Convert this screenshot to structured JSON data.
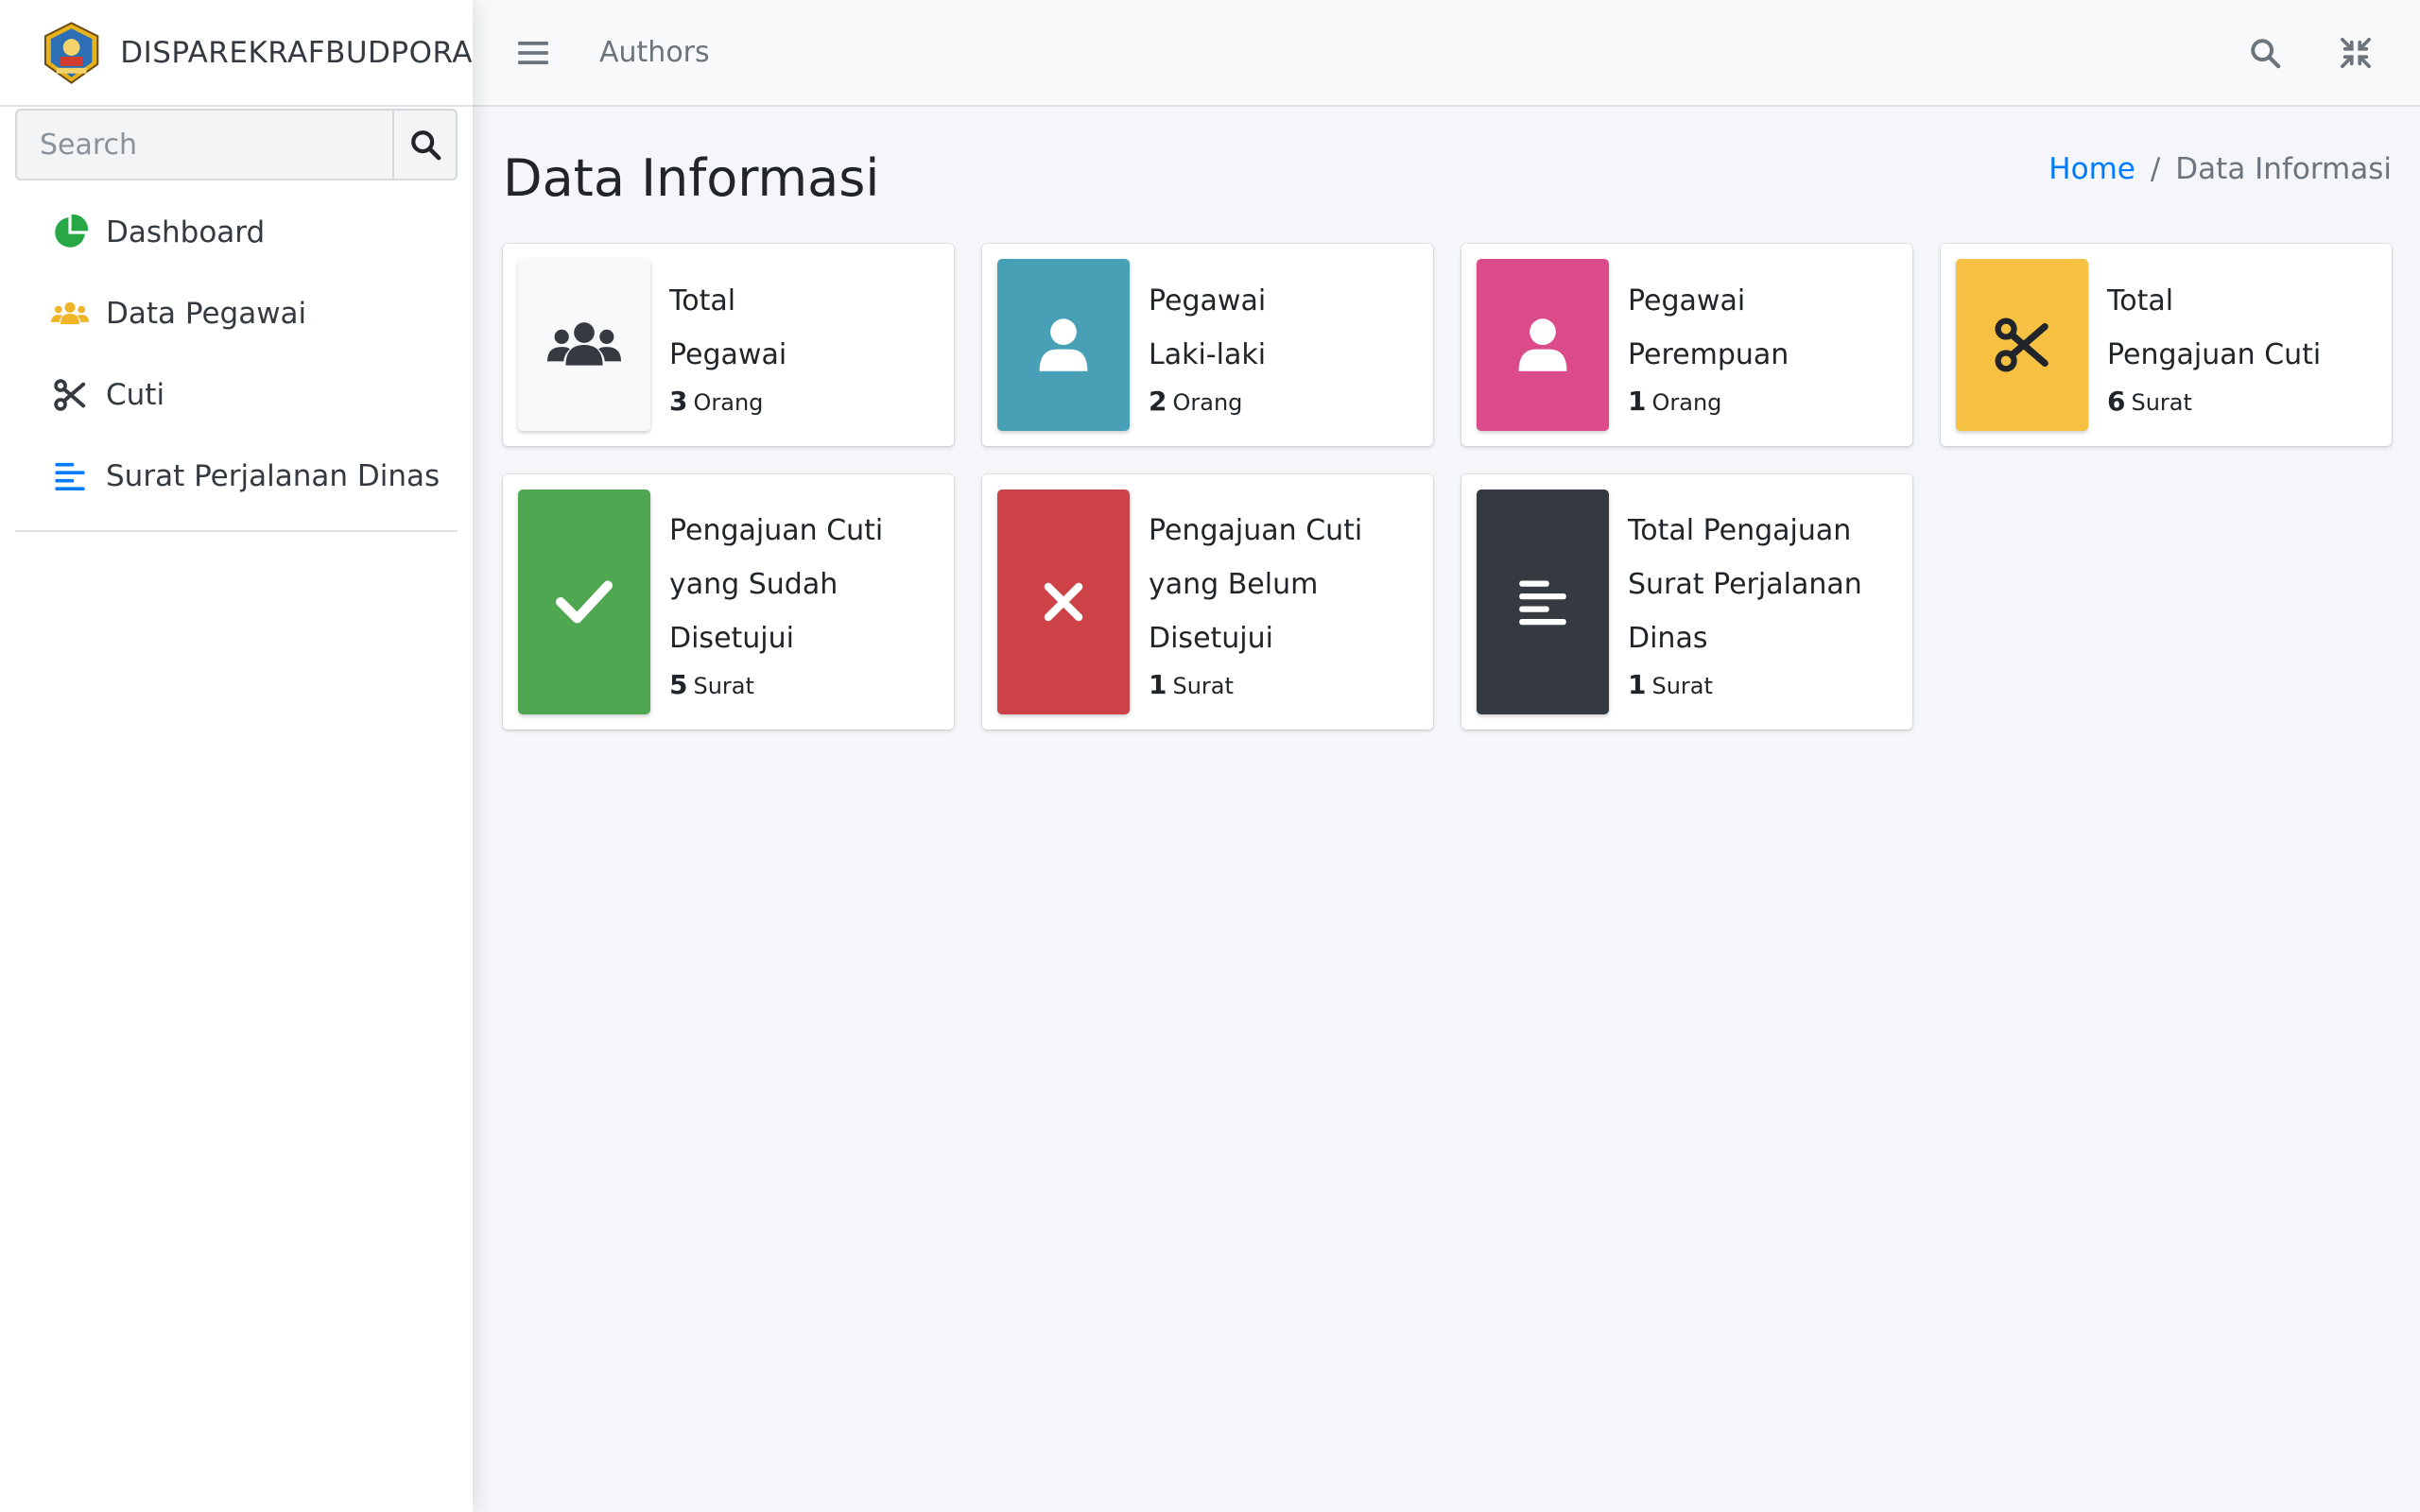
{
  "brand": {
    "name": "DISPAREKRAFBUDPORA"
  },
  "search": {
    "placeholder": "Search"
  },
  "sidebar": {
    "items": [
      {
        "label": "Dashboard",
        "icon": "chart-pie-icon",
        "color": "#28a745"
      },
      {
        "label": "Data Pegawai",
        "icon": "users-icon",
        "color": "#f0b429"
      },
      {
        "label": "Cuti",
        "icon": "scissors-icon",
        "color": "#343a40"
      },
      {
        "label": "Surat Perjalanan Dinas",
        "icon": "align-left-icon",
        "color": "#007bff"
      }
    ]
  },
  "topbar": {
    "link": "Authors"
  },
  "header": {
    "title": "Data Informasi",
    "breadcrumb": {
      "home": "Home",
      "separator": "/",
      "current": "Data Informasi"
    }
  },
  "boxes": [
    {
      "lines": [
        "Total",
        "Pegawai"
      ],
      "value": "3",
      "unit": "Orang",
      "icon": "users-icon",
      "bg": "#f8f9fa"
    },
    {
      "lines": [
        "Pegawai",
        "Laki-laki"
      ],
      "value": "2",
      "unit": "Orang",
      "icon": "user-icon",
      "bg": "#48a0b7"
    },
    {
      "lines": [
        "Pegawai",
        "Perempuan"
      ],
      "value": "1",
      "unit": "Orang",
      "icon": "user-icon",
      "bg": "#db4b8a"
    },
    {
      "lines": [
        "Total",
        "Pengajuan Cuti"
      ],
      "value": "6",
      "unit": "Surat",
      "icon": "scissors-icon",
      "bg": "#f6c142"
    },
    {
      "lines": [
        "Pengajuan Cuti",
        "yang Sudah",
        "Disetujui"
      ],
      "value": "5",
      "unit": "Surat",
      "icon": "check-icon",
      "bg": "#4fa751"
    },
    {
      "lines": [
        "Pengajuan Cuti",
        "yang Belum",
        "Disetujui"
      ],
      "value": "1",
      "unit": "Surat",
      "icon": "times-icon",
      "bg": "#cc4246"
    },
    {
      "lines": [
        "Total Pengajuan",
        "Surat Perjalanan",
        "Dinas"
      ],
      "value": "1",
      "unit": "Surat",
      "icon": "align-left-icon",
      "bg": "#343a40"
    }
  ]
}
